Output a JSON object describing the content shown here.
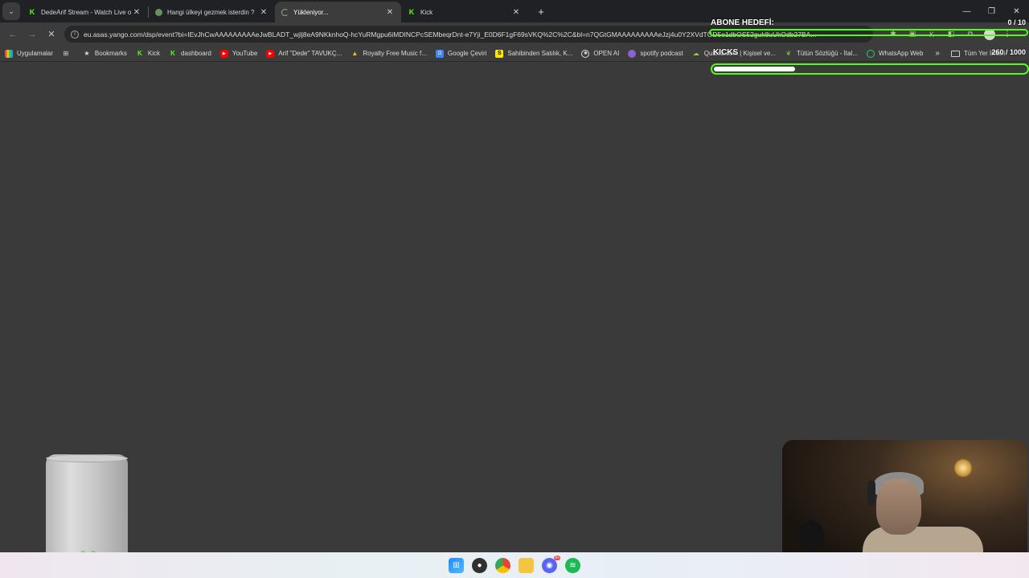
{
  "browser": {
    "tabs": [
      {
        "title": "DedeArif Stream - Watch Live o",
        "favicon": "kick-icon"
      },
      {
        "title": "Hangi ülkeyi gezmek isterdin ?",
        "favicon": "globe-icon"
      },
      {
        "title": "Yükleniyor...",
        "favicon": "loading-spinner-icon",
        "active": true
      },
      {
        "title": "Kick",
        "favicon": "kick-icon"
      }
    ],
    "new_tab_symbol": "+",
    "url": "eu.asas.yango.com/dsp/event?bi=IEvJhCwAAAAAAAAAeJwBLADT_wjlj8eA9NKknhoQ-hcYuRMgpu6iMDINCPcSEMbeqrDnt-e7Yji_E0D6F1gF69sVKQ%2C%2C&bl=n7QGtGMAAAAAAAAAeJzj4u0Y2XVdTGD5o1dbOS52guk8uUkOdb27BA..."
  },
  "bookmarks": [
    {
      "label": "Uygulamalar",
      "icon": "apps-grid-icon"
    },
    {
      "label": "Bookmarks",
      "icon": "star-icon"
    },
    {
      "label": "Kick",
      "icon": "kick-icon"
    },
    {
      "label": "dashboard",
      "icon": "kick-icon"
    },
    {
      "label": "YouTube",
      "icon": "youtube-icon"
    },
    {
      "label": "Arif \"Dede\" TAVUKÇ...",
      "icon": "youtube-icon"
    },
    {
      "label": "Royalty Free Music f...",
      "icon": "triangle-icon"
    },
    {
      "label": "Google Çeviri",
      "icon": "google-translate-icon"
    },
    {
      "label": "Sahibinden Satılık, K...",
      "icon": "sahibinden-icon"
    },
    {
      "label": "OPEN AI",
      "icon": "openai-icon"
    },
    {
      "label": "spotify podcast",
      "icon": "podcast-icon"
    },
    {
      "label": "Quizez.com | Kişisel ve...",
      "icon": "quiz-icon"
    },
    {
      "label": "Tütün Sözlüğü - İtal...",
      "icon": "leaf-icon"
    },
    {
      "label": "WhatsApp Web",
      "icon": "whatsapp-icon"
    }
  ],
  "bookmarks_more": "»",
  "bookmarks_folder": "Tüm Yer İmleri",
  "overlay": {
    "goal_title": "ABONE HEDEFİ:",
    "goal_count": "0 / 10",
    "goal_progress": 0.0,
    "kicks_title": "KICKS",
    "kicks_count": "260 / 1000",
    "kicks_progress": 0.26,
    "accent": "#53fc18"
  },
  "taskbar": {
    "icons": [
      "windows-start-icon",
      "obs-icon",
      "chrome-icon",
      "file-explorer-icon",
      "discord-icon",
      "spotify-icon"
    ],
    "discord_badge": "9+"
  }
}
